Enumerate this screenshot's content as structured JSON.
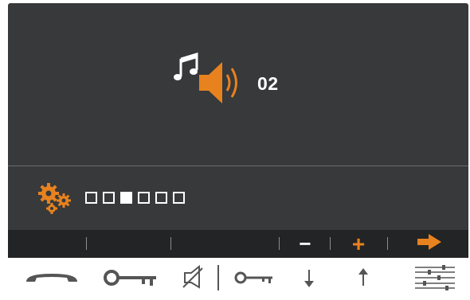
{
  "display": {
    "volume_level": "02",
    "volume_icon": "music-speaker-icon",
    "settings_icon": "gears-icon",
    "level_indicator": {
      "total": 6,
      "selected_index": 2
    }
  },
  "softkeys": {
    "minus_label": "−",
    "plus_label": "+",
    "next_icon": "arrow-right-icon"
  },
  "physical_buttons": [
    {
      "icon": "handset-icon"
    },
    {
      "icon": "key-icon"
    },
    {
      "icon": "speaker-mute-icon"
    },
    {
      "icon": "key-small-icon"
    },
    {
      "icon": "arrow-down-icon"
    },
    {
      "icon": "arrow-up-icon"
    },
    {
      "icon": "menu-sliders-icon"
    }
  ],
  "colors": {
    "screen_bg": "#37393b",
    "bar_bg": "#232425",
    "accent": "#e8821e",
    "text": "#ffffff",
    "physical_icon": "#555555"
  }
}
